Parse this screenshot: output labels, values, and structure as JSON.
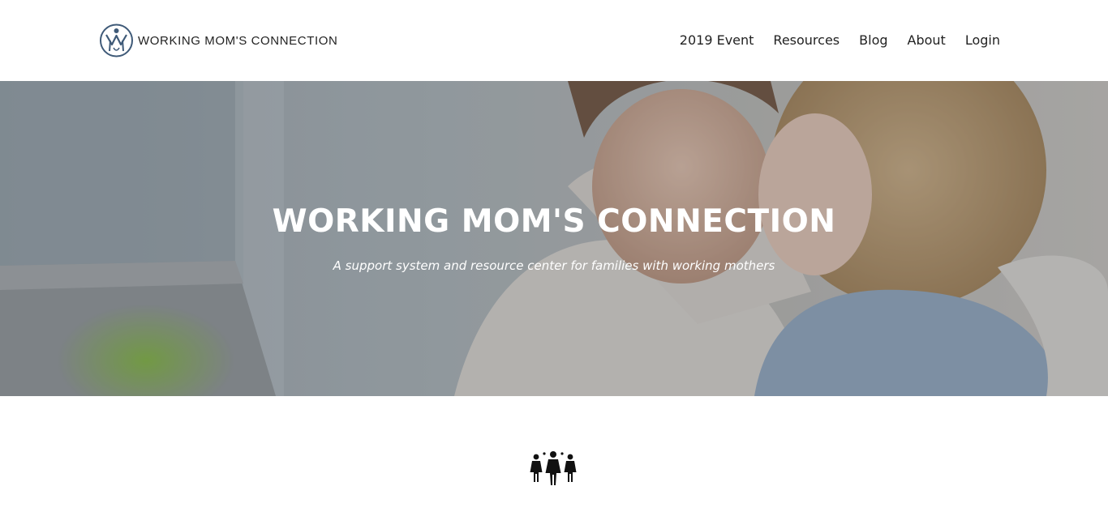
{
  "header": {
    "logo_text": "WORKING MOM'S CONNECTION",
    "logo_icon": "mom-figure-logo-icon"
  },
  "nav": {
    "items": [
      {
        "label": "2019 Event"
      },
      {
        "label": "Resources"
      },
      {
        "label": "Blog"
      },
      {
        "label": "About"
      },
      {
        "label": "Login"
      }
    ]
  },
  "hero": {
    "title": "WORKING MOM'S CONNECTION",
    "subtitle": "A support system and resource center for families with working mothers",
    "image": "mother-and-daughter-photo"
  },
  "features": {
    "icon": "group-of-women-icon"
  },
  "colors": {
    "text": "#222222",
    "background": "#ffffff",
    "logo_blue": "#3f5a78",
    "hero_text": "#ffffff"
  }
}
